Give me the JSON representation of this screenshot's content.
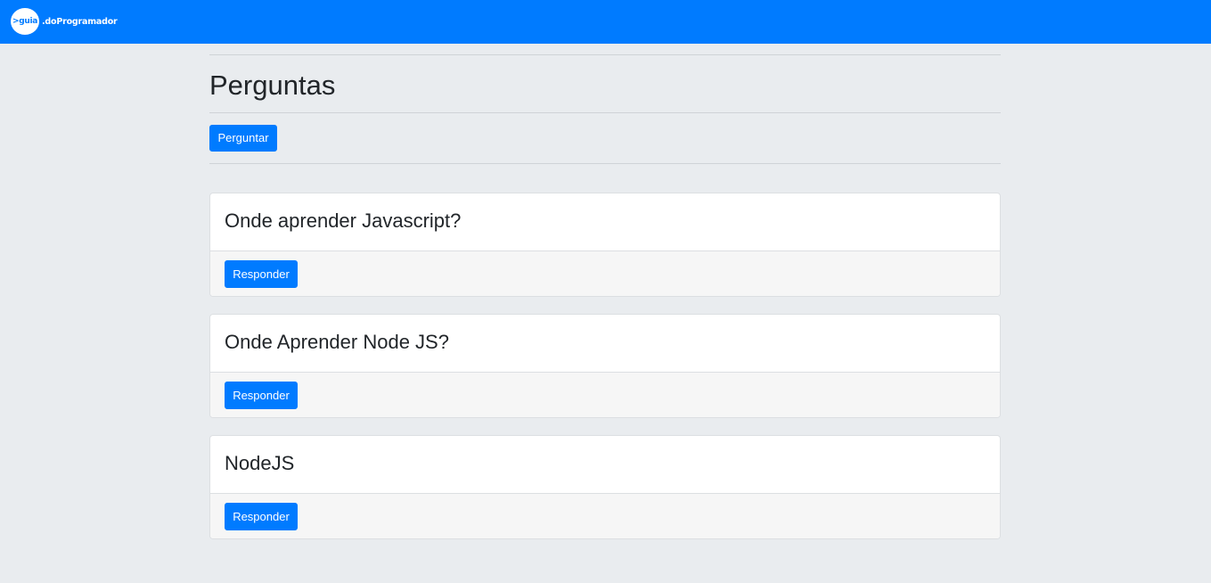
{
  "navbar": {
    "brand_badge": ">guia",
    "brand_text": ".doProgramador"
  },
  "page": {
    "title": "Perguntas",
    "ask_button_label": "Perguntar"
  },
  "questions": [
    {
      "title": "Onde aprender Javascript?",
      "answer_label": "Responder"
    },
    {
      "title": "Onde Aprender Node JS?",
      "answer_label": "Responder"
    },
    {
      "title": "NodeJS",
      "answer_label": "Responder"
    }
  ],
  "colors": {
    "primary": "#007bff",
    "background": "#e9ecef",
    "card_footer": "#f6f6f6"
  }
}
